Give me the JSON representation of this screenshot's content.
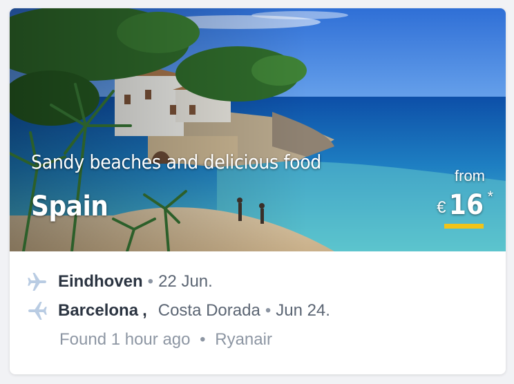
{
  "deal": {
    "tagline": "Sandy beaches and delicious food",
    "country": "Spain",
    "price": {
      "from_label": "from",
      "currency": "€",
      "amount": "16",
      "asterisk": "*"
    },
    "departure": {
      "city": "Eindhoven",
      "separator": "•",
      "date": "22 Jun."
    },
    "return": {
      "city": "Barcelona",
      "comma": ",",
      "region": "Costa Dorada",
      "separator": "•",
      "date": "Jun 24."
    },
    "footer": {
      "found_text": "Found 1 hour ago",
      "separator": "•",
      "airline": "Ryanair"
    }
  },
  "colors": {
    "price_underline": "#f0c419",
    "plane_icon": "#b9cce3",
    "city_text": "#2b3441",
    "muted_text": "#8d96a3"
  },
  "icons": {
    "departure": "plane-departure-icon",
    "return": "plane-return-icon"
  }
}
